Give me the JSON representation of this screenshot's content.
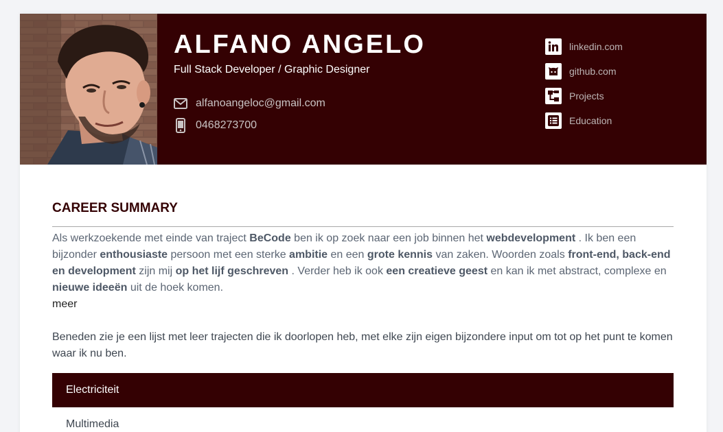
{
  "profile": {
    "name": "ALFANO ANGELO",
    "tagline": "Full Stack Developer / Graphic Designer",
    "email": "alfanoangeloc@gmail.com",
    "phone": "0468273700"
  },
  "links": [
    {
      "label": "linkedin.com",
      "icon": "linkedin-icon"
    },
    {
      "label": "github.com",
      "icon": "github-icon"
    },
    {
      "label": "Projects",
      "icon": "sitemap-icon"
    },
    {
      "label": "Education",
      "icon": "list-icon"
    }
  ],
  "summary": {
    "title": "CAREER SUMMARY",
    "p1": [
      "Als werkzoekende met einde van traject ",
      "BeCode",
      " ben ik op zoek naar een job binnen het ",
      "webdevelopment",
      " . Ik ben een bijzonder ",
      "enthousiaste",
      " persoon met een sterke ",
      "ambitie",
      " en een ",
      "grote kennis",
      " van zaken. Woorden zoals ",
      "front-end, back-end en development",
      " zijn mij ",
      "op het lijf geschreven",
      " . Verder heb ik ook ",
      "een creatieve geest",
      " en kan ik met abstract, complexe en ",
      "nieuwe ideeën",
      " uit de hoek komen."
    ],
    "more": "meer",
    "p2": "Beneden zie je een lijst met leer trajecten die ik doorlopen heb, met elke zijn eigen bijzondere input om tot op het punt te komen waar ik nu ben."
  },
  "tracks": [
    {
      "label": "Electriciteit",
      "active": true
    },
    {
      "label": "Multimedia",
      "active": false
    }
  ],
  "colors": {
    "header_bg": "#340103",
    "accent": "#340103",
    "page_bg": "#f3f4f7"
  }
}
